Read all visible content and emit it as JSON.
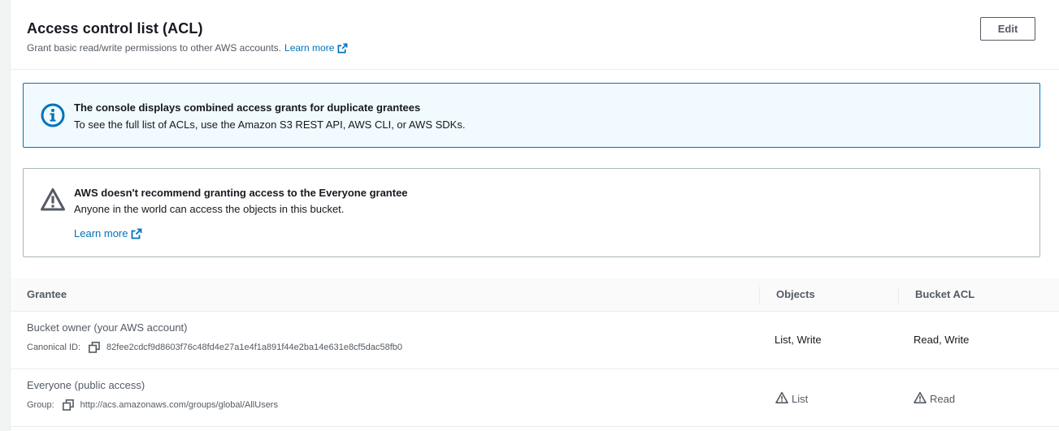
{
  "header": {
    "title": "Access control list (ACL)",
    "description": "Grant basic read/write permissions to other AWS accounts.",
    "learn_more": "Learn more",
    "edit_label": "Edit"
  },
  "info_alert": {
    "title": "The console displays combined access grants for duplicate grantees",
    "text": "To see the full list of ACLs, use the Amazon S3 REST API, AWS CLI, or AWS SDKs.",
    "icon": "info-icon"
  },
  "warning_alert": {
    "title": "AWS doesn't recommend granting access to the Everyone grantee",
    "text": "Anyone in the world can access the objects in this bucket.",
    "learn_more": "Learn more",
    "icon": "warning-icon"
  },
  "table": {
    "columns": {
      "grantee": "Grantee",
      "objects": "Objects",
      "bucket_acl": "Bucket ACL"
    },
    "rows": [
      {
        "grantee": "Bucket owner (your AWS account)",
        "id_label": "Canonical ID:",
        "id_value": "82fee2cdcf9d8603f76c48fd4e27a1e4f1a891f44e2ba14e631e8cf5dac58fb0",
        "objects": "List, Write",
        "bucket_acl": "Read, Write"
      },
      {
        "grantee": "Everyone (public access)",
        "id_label": "Group:",
        "id_value": "http://acs.amazonaws.com/groups/global/AllUsers",
        "objects": "List",
        "bucket_acl": "Read"
      }
    ]
  },
  "colors": {
    "link": "#0073bb",
    "info_border": "#0073bb",
    "info_bg": "#f1faff",
    "text_secondary": "#545b64"
  }
}
